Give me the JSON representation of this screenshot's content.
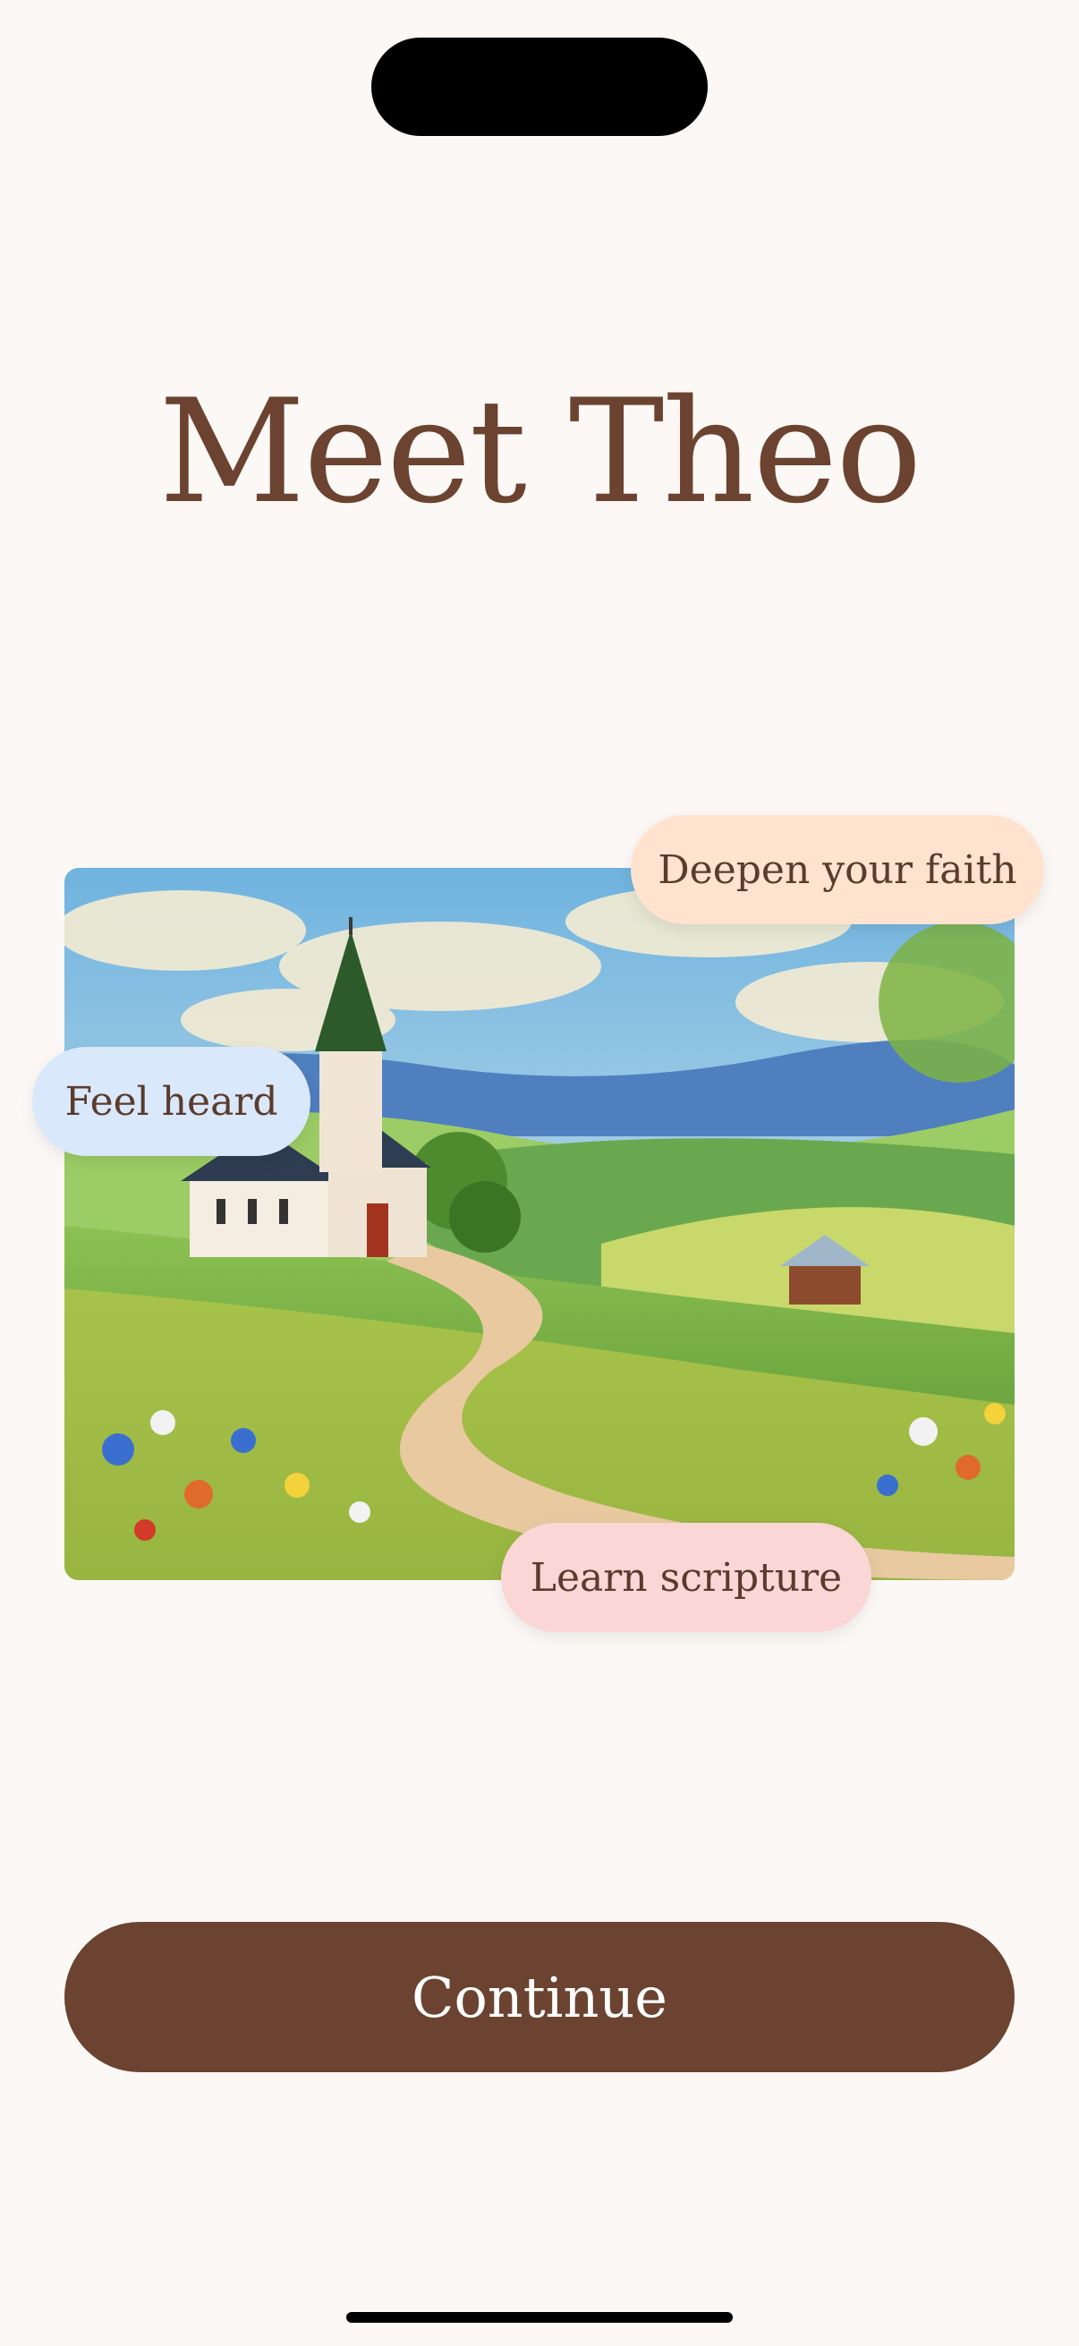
{
  "onboarding": {
    "title": "Meet Theo",
    "pills": {
      "faith": "Deepen your faith",
      "heard": "Feel heard",
      "scripture": "Learn scripture"
    },
    "continue_label": "Continue"
  },
  "colors": {
    "background": "#fcf8f5",
    "brand_brown": "#6b4330",
    "pill_faith": "#ffe3cf",
    "pill_heard": "#d9e8fb",
    "pill_scripture": "#fbd6d6"
  }
}
